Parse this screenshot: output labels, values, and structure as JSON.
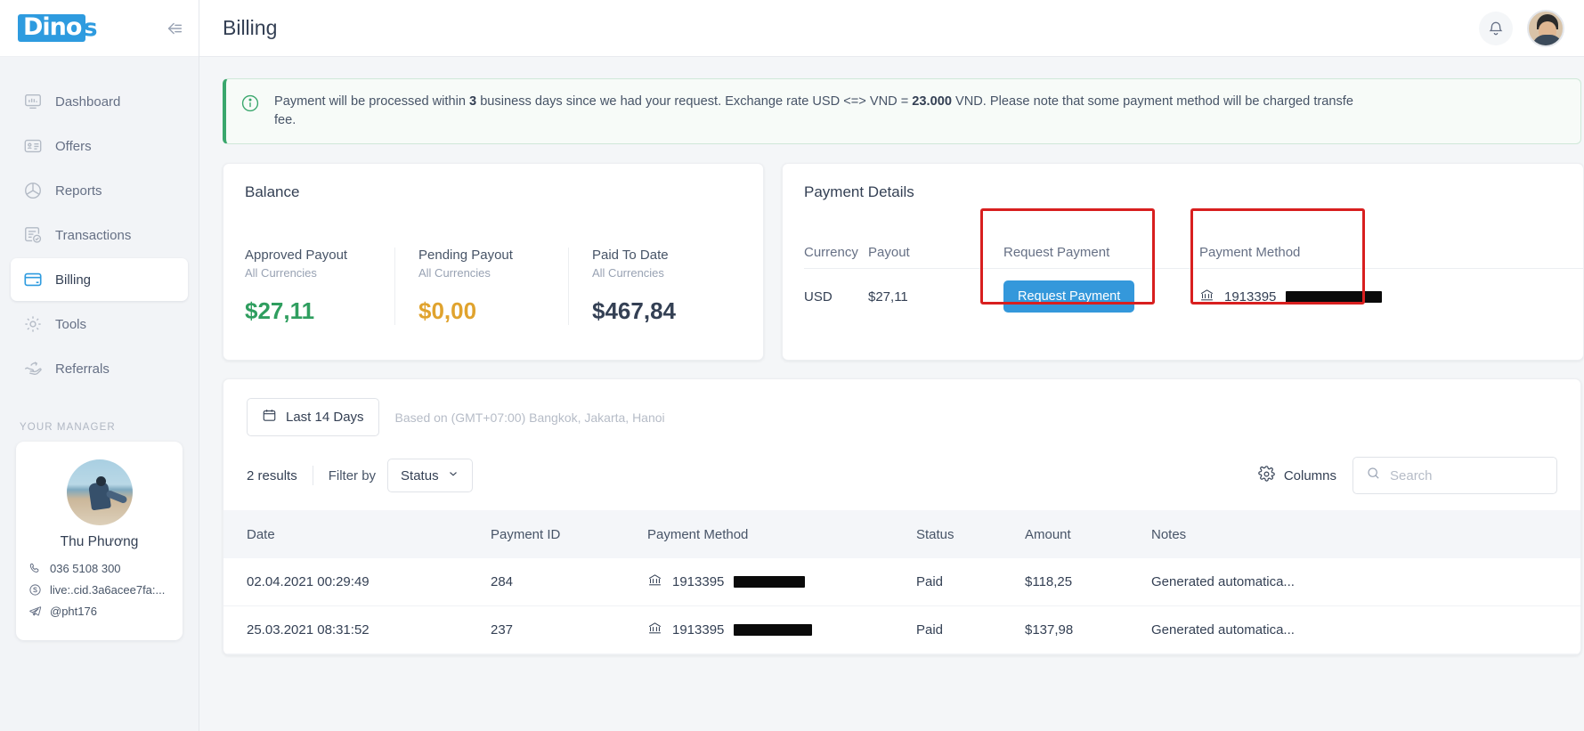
{
  "brand": {
    "logo_main": "Dino",
    "logo_tail": "s",
    "collapse_icon": "collapse-sidebar-icon"
  },
  "sidebar": {
    "items": [
      {
        "label": "Dashboard",
        "icon": "dashboard-icon",
        "active": false
      },
      {
        "label": "Offers",
        "icon": "offers-icon",
        "active": false
      },
      {
        "label": "Reports",
        "icon": "reports-icon",
        "active": false
      },
      {
        "label": "Transactions",
        "icon": "transactions-icon",
        "active": false
      },
      {
        "label": "Billing",
        "icon": "billing-icon",
        "active": true
      },
      {
        "label": "Tools",
        "icon": "tools-icon",
        "active": false
      },
      {
        "label": "Referrals",
        "icon": "referrals-icon",
        "active": false
      }
    ],
    "manager_heading": "YOUR MANAGER",
    "manager": {
      "name": "Thu Phương",
      "phone": "036 5108 300",
      "skype": "live:.cid.3a6acee7fa:...",
      "telegram": "@pht176"
    }
  },
  "header": {
    "title": "Billing",
    "bell_icon": "notification-bell-icon",
    "avatar": "user-avatar"
  },
  "banner": {
    "icon": "info-circle-icon",
    "text_pre": "Payment will be processed within ",
    "days": "3",
    "text_mid": " business days since we had your request. Exchange rate USD <=> VND = ",
    "rate": "23.000",
    "text_post": " VND. Please note that some payment method will be charged transfe",
    "second_line": "fee."
  },
  "balance": {
    "title": "Balance",
    "columns": [
      {
        "label": "Approved Payout",
        "sub": "All Currencies",
        "value": "$27,11",
        "color": "#2f9e5f"
      },
      {
        "label": "Pending Payout",
        "sub": "All Currencies",
        "value": "$0,00",
        "color": "#e0a32e"
      },
      {
        "label": "Paid To Date",
        "sub": "All Currencies",
        "value": "$467,84",
        "color": "#344054"
      }
    ]
  },
  "payment_details": {
    "title": "Payment Details",
    "headers": {
      "currency": "Currency",
      "payout": "Payout",
      "request_payment": "Request Payment",
      "payment_method": "Payment Method"
    },
    "row": {
      "currency": "USD",
      "payout": "$27,11",
      "request_button": "Request Payment",
      "method_icon": "bank-icon",
      "method_value": "1913395"
    }
  },
  "table_panel": {
    "date_filter": {
      "icon": "calendar-icon",
      "label": "Last 14 Days"
    },
    "timezone_note": "Based on (GMT+07:00) Bangkok, Jakarta, Hanoi",
    "results": "2 results",
    "filter_by_label": "Filter by",
    "status_filter": {
      "label": "Status",
      "chevron": "chevron-down-icon"
    },
    "columns_button": {
      "icon": "gear-icon",
      "label": "Columns"
    },
    "search": {
      "icon": "search-icon",
      "placeholder": "Search",
      "value": ""
    },
    "headers": [
      "Date",
      "Payment ID",
      "Payment Method",
      "Status",
      "Amount",
      "Notes"
    ],
    "rows": [
      {
        "date": "02.04.2021 00:29:49",
        "payment_id": "284",
        "method_icon": "bank-icon",
        "method": "1913395",
        "status": "Paid",
        "amount": "$118,25",
        "notes": "Generated automatica..."
      },
      {
        "date": "25.03.2021 08:31:52",
        "payment_id": "237",
        "method_icon": "bank-icon",
        "method": "1913395",
        "status": "Paid",
        "amount": "$137,98",
        "notes": "Generated automatica..."
      }
    ]
  }
}
